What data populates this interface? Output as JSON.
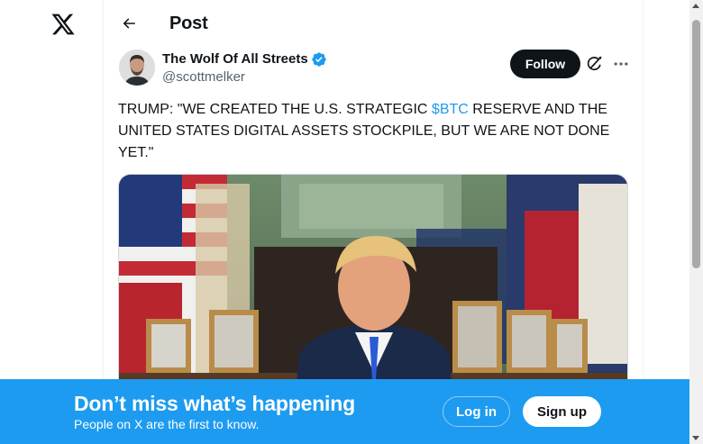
{
  "header": {
    "title": "Post",
    "logo_icon": "x-logo-icon",
    "back_icon": "arrow-left-icon"
  },
  "tweet": {
    "author": {
      "display_name": "The Wolf Of All Streets",
      "handle": "@scottmelker",
      "verified": true,
      "verified_color": "#1d9bf0"
    },
    "follow_label": "Follow",
    "grok_icon": "grok-icon",
    "more_icon": "more-horizontal-icon",
    "text_before": "TRUMP: \"WE CREATED THE U.S. STRATEGIC ",
    "cashtag": "$BTC",
    "text_after": " RESERVE AND THE UNITED STATES DIGITAL ASSETS STOCKPILE, BUT WE ARE NOT DONE YET.\"",
    "media_type": "video-thumbnail"
  },
  "banner": {
    "title": "Don’t miss what’s happening",
    "subtitle": "People on X are the first to know.",
    "login_label": "Log in",
    "signup_label": "Sign up",
    "background": "#1d9bf0"
  },
  "colors": {
    "text": "#0f1419",
    "secondary": "#536471",
    "accent": "#1d9bf0"
  }
}
